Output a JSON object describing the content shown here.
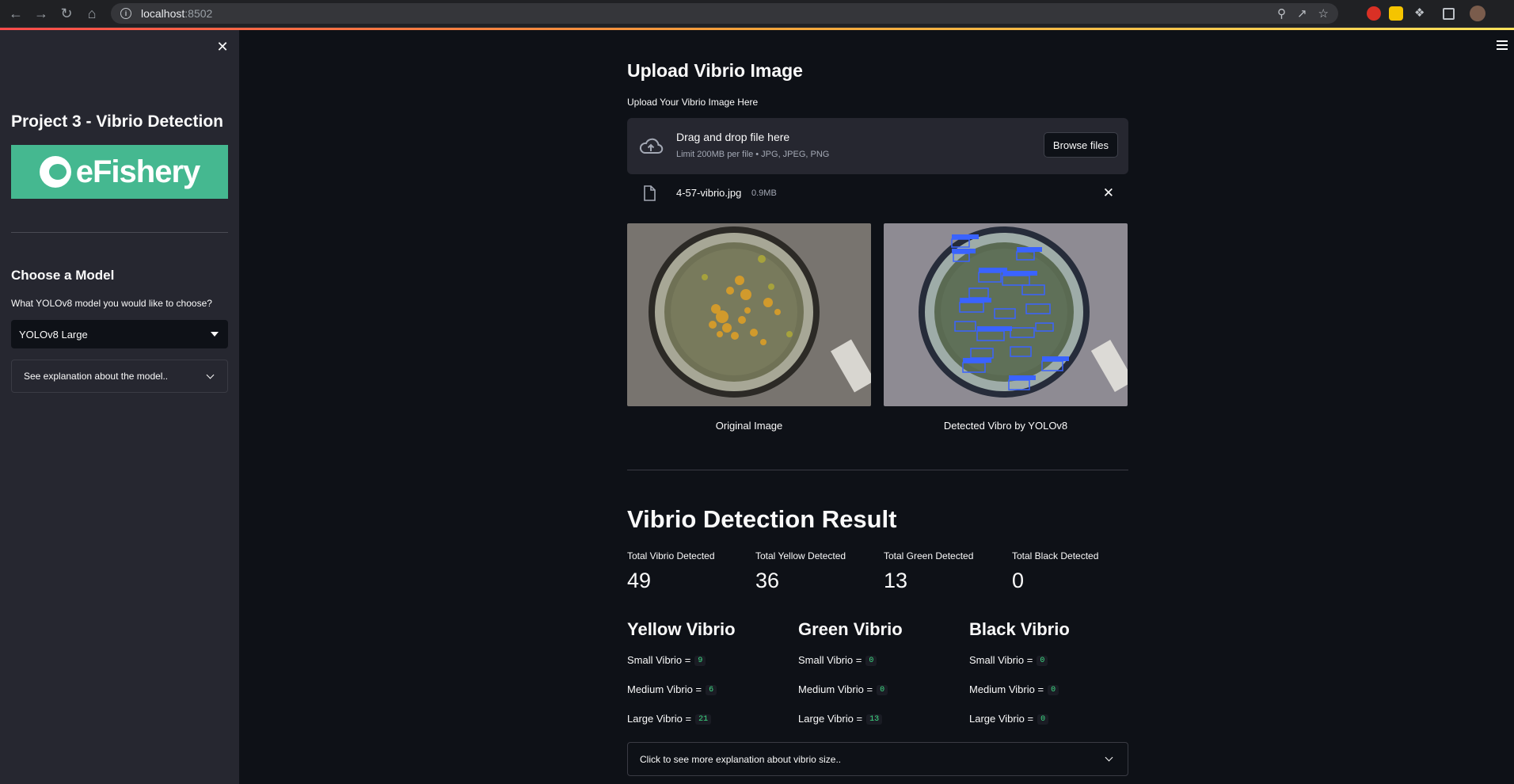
{
  "browser": {
    "url_host": "localhost",
    "url_port": ":8502"
  },
  "sidebar": {
    "title": "Project 3 - Vibrio Detection",
    "logo_text": "eFishery",
    "model_heading": "Choose a Model",
    "model_question": "What YOLOv8 model you would like to choose?",
    "model_selected": "YOLOv8 Large",
    "model_expander": "See explanation about the model.."
  },
  "upload": {
    "heading": "Upload Vibrio Image",
    "label": "Upload Your Vibrio Image Here",
    "drop_title": "Drag and drop file here",
    "drop_limit": "Limit 200MB per file • JPG, JPEG, PNG",
    "browse_label": "Browse files",
    "file_name": "4-57-vibrio.jpg",
    "file_size": "0.9MB"
  },
  "images": {
    "original_caption": "Original Image",
    "detected_caption": "Detected Vibro by YOLOv8"
  },
  "result": {
    "heading": "Vibrio Detection Result",
    "metrics": [
      {
        "label": "Total Vibrio Detected",
        "value": "49"
      },
      {
        "label": "Total Yellow Detected",
        "value": "36"
      },
      {
        "label": "Total Green Detected",
        "value": "13"
      },
      {
        "label": "Total Black Detected",
        "value": "0"
      }
    ],
    "groups": [
      {
        "title": "Yellow Vibrio",
        "rows": [
          {
            "label": "Small Vibrio =",
            "value": "9"
          },
          {
            "label": "Medium Vibrio =",
            "value": "6"
          },
          {
            "label": "Large Vibrio =",
            "value": "21"
          }
        ]
      },
      {
        "title": "Green Vibrio",
        "rows": [
          {
            "label": "Small Vibrio =",
            "value": "0"
          },
          {
            "label": "Medium Vibrio =",
            "value": "0"
          },
          {
            "label": "Large Vibrio =",
            "value": "13"
          }
        ]
      },
      {
        "title": "Black Vibrio",
        "rows": [
          {
            "label": "Small Vibrio =",
            "value": "0"
          },
          {
            "label": "Medium Vibrio =",
            "value": "0"
          },
          {
            "label": "Large Vibrio =",
            "value": "0"
          }
        ]
      }
    ],
    "size_expander": "Click to see more explanation about vibrio size.."
  }
}
